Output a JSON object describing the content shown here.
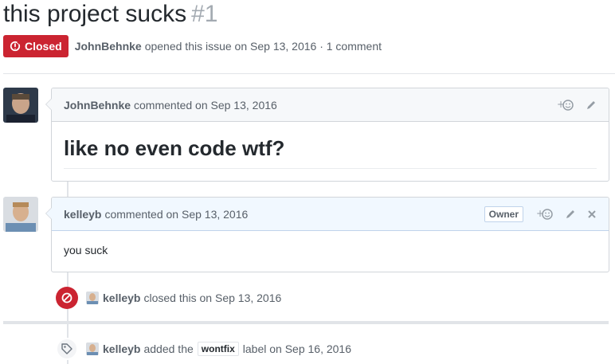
{
  "issue": {
    "title": "this project sucks",
    "number": "#1",
    "state": "Closed",
    "author": "JohnBehnke",
    "opened_text": "opened this issue on Sep 13, 2016 · 1 comment"
  },
  "comments": [
    {
      "author": "JohnBehnke",
      "action": "commented on Sep 13, 2016",
      "body": "like no even code wtf?",
      "reaction_icon": "add-reaction-icon",
      "edit_icon": "pencil-icon"
    },
    {
      "author": "kelleyb",
      "action": "commented on Sep 13, 2016",
      "badge": "Owner",
      "body": "you suck",
      "reaction_icon": "add-reaction-icon",
      "edit_icon": "pencil-icon",
      "delete_icon": "close-icon"
    }
  ],
  "events": [
    {
      "icon": "circle-slash-icon",
      "actor": "kelleyb",
      "text": "closed this on Sep 13, 2016"
    },
    {
      "icon": "tag-icon",
      "actor": "kelleyb",
      "text_before": "added the",
      "label": "wontfix",
      "text_after": "label on Sep 16, 2016"
    }
  ],
  "colors": {
    "closed_red": "#cb2431",
    "owner_header": "#f1f8ff",
    "muted_text": "#586069"
  }
}
